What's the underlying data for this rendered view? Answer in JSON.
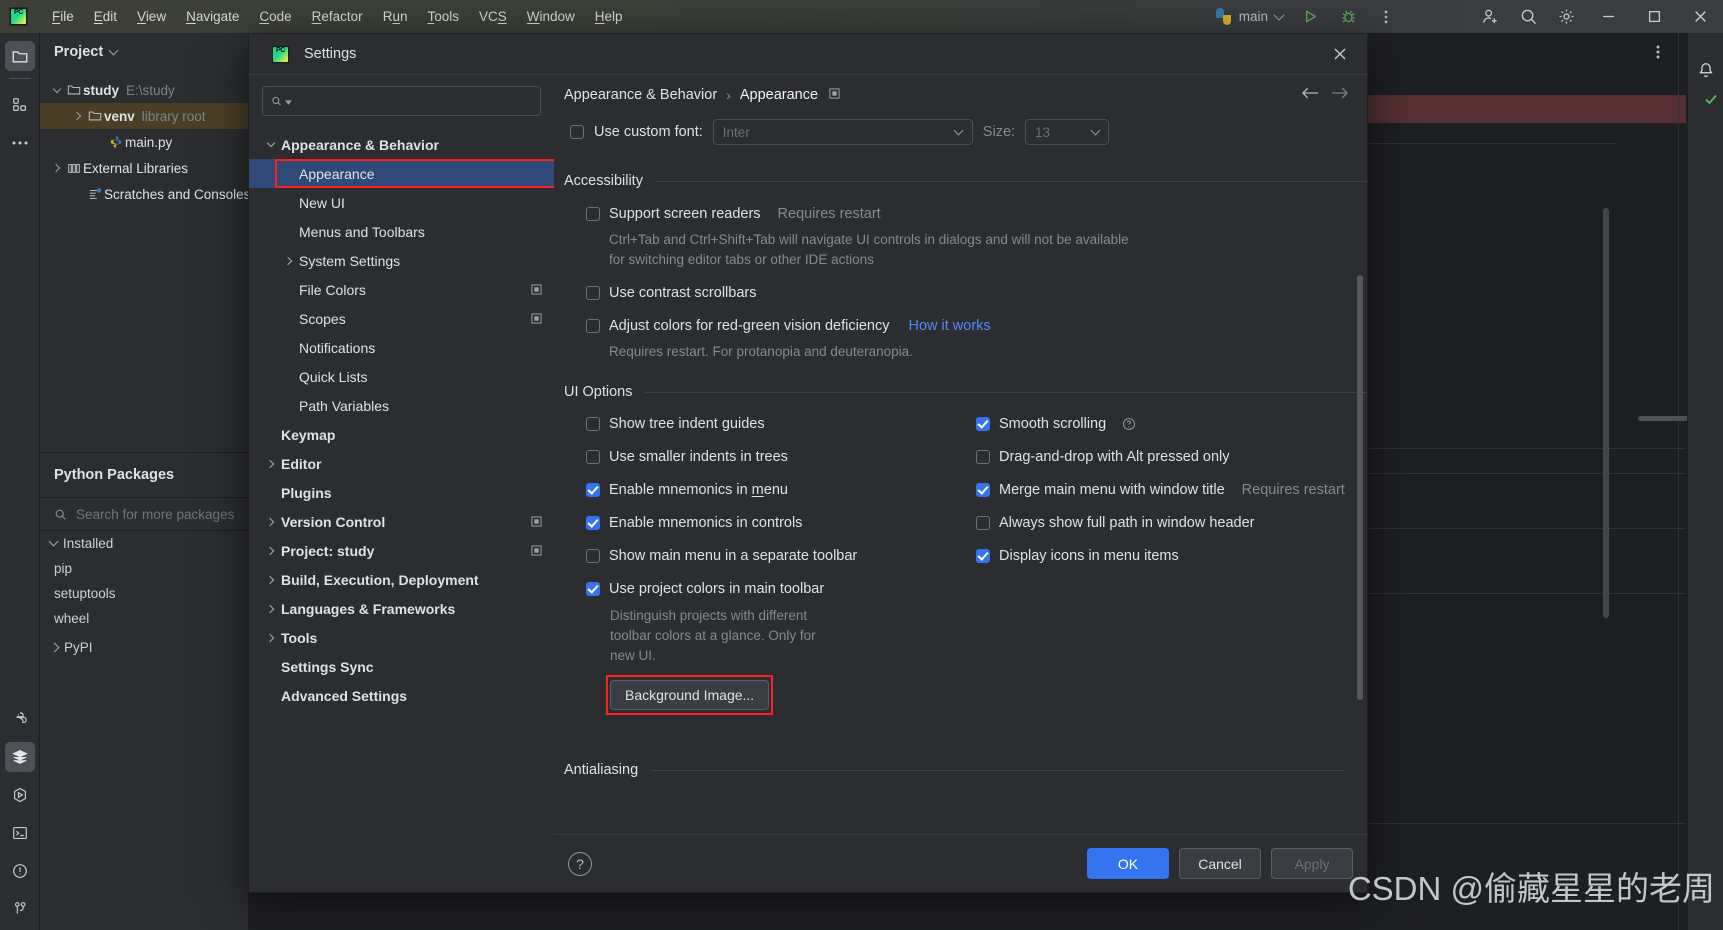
{
  "app": {
    "logo_icon": "pycharm-logo-icon",
    "menus": [
      {
        "label": "File",
        "mnemonic": "F"
      },
      {
        "label": "Edit",
        "mnemonic": "E"
      },
      {
        "label": "View",
        "mnemonic": "V"
      },
      {
        "label": "Navigate",
        "mnemonic": "N"
      },
      {
        "label": "Code",
        "mnemonic": "C"
      },
      {
        "label": "Refactor",
        "mnemonic": "R"
      },
      {
        "label": "Run",
        "mnemonic": "u"
      },
      {
        "label": "Tools",
        "mnemonic": "T"
      },
      {
        "label": "VCS",
        "mnemonic": "S"
      },
      {
        "label": "Window",
        "mnemonic": "W"
      },
      {
        "label": "Help",
        "mnemonic": "H"
      }
    ],
    "run_config": "main",
    "toolbar_icons": [
      "python-icon",
      "run-icon",
      "debug-icon",
      "more-vertical-icon",
      "add-user-icon",
      "search-icon",
      "gear-icon"
    ],
    "window_controls": [
      "minimize-icon",
      "maximize-icon",
      "close-icon"
    ],
    "accent": "#3574f0",
    "titlebar_color": "#3c4036"
  },
  "rail": {
    "top_items": [
      "project-folder-icon",
      "structure-icon",
      "more-dots-icon"
    ],
    "bottom_items": [
      "python-console-icon",
      "python-packages-icon",
      "run-icon",
      "terminal-icon",
      "problems-icon",
      "version-control-icon"
    ]
  },
  "project": {
    "title": "Project",
    "tree": [
      {
        "label": "study",
        "sub": "E:\\study",
        "icon": "folder-icon",
        "arrow": "down",
        "indent": 0,
        "bold": true,
        "selected": false
      },
      {
        "label": "venv",
        "sub": "library root",
        "icon": "folder-icon",
        "arrow": "right",
        "indent": 1,
        "bold": true,
        "selected": true
      },
      {
        "label": "main.py",
        "sub": "",
        "icon": "python-file-icon",
        "arrow": "none",
        "indent": 2,
        "bold": false,
        "selected": false
      },
      {
        "label": "External Libraries",
        "sub": "",
        "icon": "library-icon",
        "arrow": "right",
        "indent": 0,
        "bold": false,
        "selected": false
      },
      {
        "label": "Scratches and Consoles",
        "sub": "",
        "icon": "scratch-icon",
        "arrow": "none",
        "indent": 1,
        "bold": false,
        "selected": false
      }
    ]
  },
  "packages": {
    "title": "Python Packages",
    "search_placeholder": "Search for more packages",
    "search_icon": "search-icon",
    "group_label": "Installed",
    "items": [
      "pip",
      "setuptools",
      "wheel"
    ],
    "repo_label": "PyPI"
  },
  "dialog": {
    "title": "Settings",
    "title_icon": "pycharm-logo-icon",
    "close_icon": "close-icon",
    "search": {
      "value": "",
      "placeholder": "",
      "icon": "search-dropdown-icon"
    },
    "tree": [
      {
        "label": "Appearance & Behavior",
        "indent": 0,
        "arrow": "down",
        "bold": true,
        "selected": false,
        "badge": ""
      },
      {
        "label": "Appearance",
        "indent": 1,
        "arrow": "none",
        "bold": false,
        "selected": true,
        "badge": "",
        "highlighted": true
      },
      {
        "label": "New UI",
        "indent": 1,
        "arrow": "none",
        "bold": false,
        "selected": false,
        "badge": ""
      },
      {
        "label": "Menus and Toolbars",
        "indent": 1,
        "arrow": "none",
        "bold": false,
        "selected": false,
        "badge": ""
      },
      {
        "label": "System Settings",
        "indent": 1,
        "arrow": "right",
        "bold": false,
        "selected": false,
        "badge": ""
      },
      {
        "label": "File Colors",
        "indent": 1,
        "arrow": "none",
        "bold": false,
        "selected": false,
        "badge": "project-scope-icon"
      },
      {
        "label": "Scopes",
        "indent": 1,
        "arrow": "none",
        "bold": false,
        "selected": false,
        "badge": "project-scope-icon"
      },
      {
        "label": "Notifications",
        "indent": 1,
        "arrow": "none",
        "bold": false,
        "selected": false,
        "badge": ""
      },
      {
        "label": "Quick Lists",
        "indent": 1,
        "arrow": "none",
        "bold": false,
        "selected": false,
        "badge": ""
      },
      {
        "label": "Path Variables",
        "indent": 1,
        "arrow": "none",
        "bold": false,
        "selected": false,
        "badge": ""
      },
      {
        "label": "Keymap",
        "indent": 0,
        "arrow": "none",
        "bold": true,
        "selected": false,
        "badge": ""
      },
      {
        "label": "Editor",
        "indent": 0,
        "arrow": "right",
        "bold": true,
        "selected": false,
        "badge": ""
      },
      {
        "label": "Plugins",
        "indent": 0,
        "arrow": "none",
        "bold": true,
        "selected": false,
        "badge": ""
      },
      {
        "label": "Version Control",
        "indent": 0,
        "arrow": "right",
        "bold": true,
        "selected": false,
        "badge": "project-scope-icon"
      },
      {
        "label": "Project: study",
        "indent": 0,
        "arrow": "right",
        "bold": true,
        "selected": false,
        "badge": "project-scope-icon"
      },
      {
        "label": "Build, Execution, Deployment",
        "indent": 0,
        "arrow": "right",
        "bold": true,
        "selected": false,
        "badge": ""
      },
      {
        "label": "Languages & Frameworks",
        "indent": 0,
        "arrow": "right",
        "bold": true,
        "selected": false,
        "badge": ""
      },
      {
        "label": "Tools",
        "indent": 0,
        "arrow": "right",
        "bold": true,
        "selected": false,
        "badge": ""
      },
      {
        "label": "Settings Sync",
        "indent": 0,
        "arrow": "none",
        "bold": true,
        "selected": false,
        "badge": ""
      },
      {
        "label": "Advanced Settings",
        "indent": 0,
        "arrow": "none",
        "bold": true,
        "selected": false,
        "badge": ""
      }
    ],
    "breadcrumb": {
      "root": "Appearance & Behavior",
      "separator": "›",
      "current": "Appearance",
      "badge_icon": "project-scope-icon"
    },
    "nav": {
      "back_icon": "arrow-left-icon",
      "forward_icon": "arrow-right-icon"
    },
    "font_row": {
      "checkbox_label": "Use custom font:",
      "checked": false,
      "font_value": "Inter",
      "size_label": "Size:",
      "size_value": "13"
    },
    "accessibility": {
      "section_title": "Accessibility",
      "items": [
        {
          "label": "Support screen readers",
          "checked": false,
          "hint": "Requires restart",
          "link": "",
          "desc": "Ctrl+Tab and Ctrl+Shift+Tab will navigate UI controls in dialogs and will not be available for switching editor tabs or other IDE actions"
        },
        {
          "label": "Use contrast scrollbars",
          "checked": false,
          "hint": "",
          "link": "",
          "desc": ""
        },
        {
          "label": "Adjust colors for red-green vision deficiency",
          "checked": false,
          "hint": "",
          "link": "How it works",
          "desc": "Requires restart. For protanopia and deuteranopia."
        }
      ]
    },
    "ui_options": {
      "section_title": "UI Options",
      "left": [
        {
          "label": "Show tree indent guides",
          "checked": false,
          "mnemonic": "",
          "hint": "",
          "help": false
        },
        {
          "label": "Use smaller indents in trees",
          "checked": false,
          "mnemonic": "",
          "hint": "",
          "help": false
        },
        {
          "label": "Enable mnemonics in menu",
          "checked": true,
          "mnemonic": "m",
          "hint": "",
          "help": false
        },
        {
          "label": "Enable mnemonics in controls",
          "checked": true,
          "mnemonic": "",
          "hint": "",
          "help": false
        },
        {
          "label": "Show main menu in a separate toolbar",
          "checked": false,
          "mnemonic": "",
          "hint": "",
          "help": false
        },
        {
          "label": "Use project colors in main toolbar",
          "checked": true,
          "mnemonic": "",
          "hint": "",
          "help": false
        }
      ],
      "left_desc": "Distinguish projects with different toolbar colors at a glance. Only for new UI.",
      "background_image_button": "Background Image...",
      "right": [
        {
          "label": "Smooth scrolling",
          "checked": true,
          "hint": "",
          "help": true
        },
        {
          "label": "Drag-and-drop with Alt pressed only",
          "checked": false,
          "hint": "",
          "help": false
        },
        {
          "label": "Merge main menu with window title",
          "checked": true,
          "hint": "Requires restart",
          "help": false
        },
        {
          "label": "Always show full path in window header",
          "checked": false,
          "hint": "",
          "help": false
        },
        {
          "label": "Display icons in menu items",
          "checked": true,
          "hint": "",
          "help": false
        }
      ]
    },
    "antialiasing": {
      "section_title": "Antialiasing"
    },
    "footer": {
      "help_icon": "question-mark-icon",
      "ok": "OK",
      "cancel": "Cancel",
      "apply": "Apply"
    }
  },
  "watermark": "CSDN @偷藏星星的老周"
}
